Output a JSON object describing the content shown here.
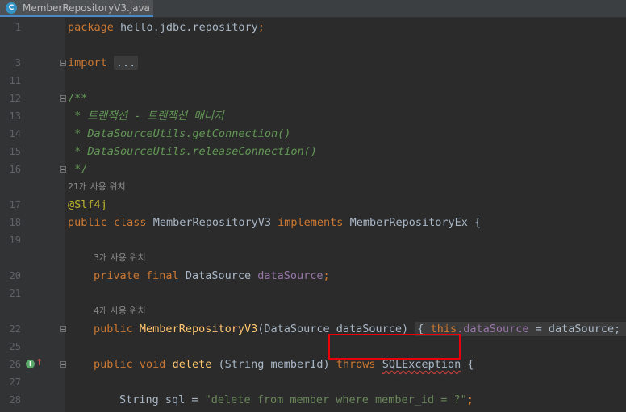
{
  "tab": {
    "filename": "MemberRepositoryV3.java",
    "icon_letter": "C",
    "close": "×"
  },
  "hints": {
    "h17": "21개 사용 위치",
    "h20": "3개 사용 위치",
    "h22": "4개 사용 위치"
  },
  "lines": {
    "l1": "1",
    "l3": "3",
    "l11": "11",
    "l12": "12",
    "l13": "13",
    "l14": "14",
    "l15": "15",
    "l16": "16",
    "l17": "17",
    "l18": "18",
    "l19": "19",
    "l20": "20",
    "l21": "21",
    "l22": "22",
    "l25": "25",
    "l26": "26",
    "l27": "27",
    "l28": "28"
  },
  "code": {
    "package_kw": "package",
    "package_name": " hello.jdbc.repository",
    "semicolon": ";",
    "import_kw": "import",
    "import_fold": "...",
    "jdoc_open": "/**",
    "jdoc_13": " * 트랜잭션 - 트랜잭션 매니저",
    "jdoc_14": " * DataSourceUtils.getConnection()",
    "jdoc_15": " * DataSourceUtils.releaseConnection()",
    "jdoc_close": " */",
    "annotation": "@Slf4j",
    "class_public": "public",
    "class_kw": "class",
    "class_name": "MemberRepositoryV3",
    "implements_kw": "implements",
    "iface_name": "MemberRepositoryEx",
    "open_brace": "{",
    "private_kw": "private",
    "final_kw": "final",
    "ds_type": "DataSource",
    "ds_field": "dataSource",
    "ctor_public": "public",
    "ctor_name": "MemberRepositoryV3",
    "ctor_params": "(DataSource dataSource)",
    "ctor_body_open": "{",
    "this_kw": "this",
    "ctor_dot_field": ".dataSource",
    "ctor_assign": " = dataSource;",
    "ctor_body_close": "}",
    "del_public": "public",
    "del_void": "void",
    "del_name": "delete",
    "del_params": " (String memberId) ",
    "throws_kw": "throws",
    "sql_exception": "SQLException",
    "del_brace": " {",
    "sql_type": "String sql = ",
    "sql_string": "\"delete from member where member_id = ?\"",
    "sql_semicolon": ";"
  }
}
